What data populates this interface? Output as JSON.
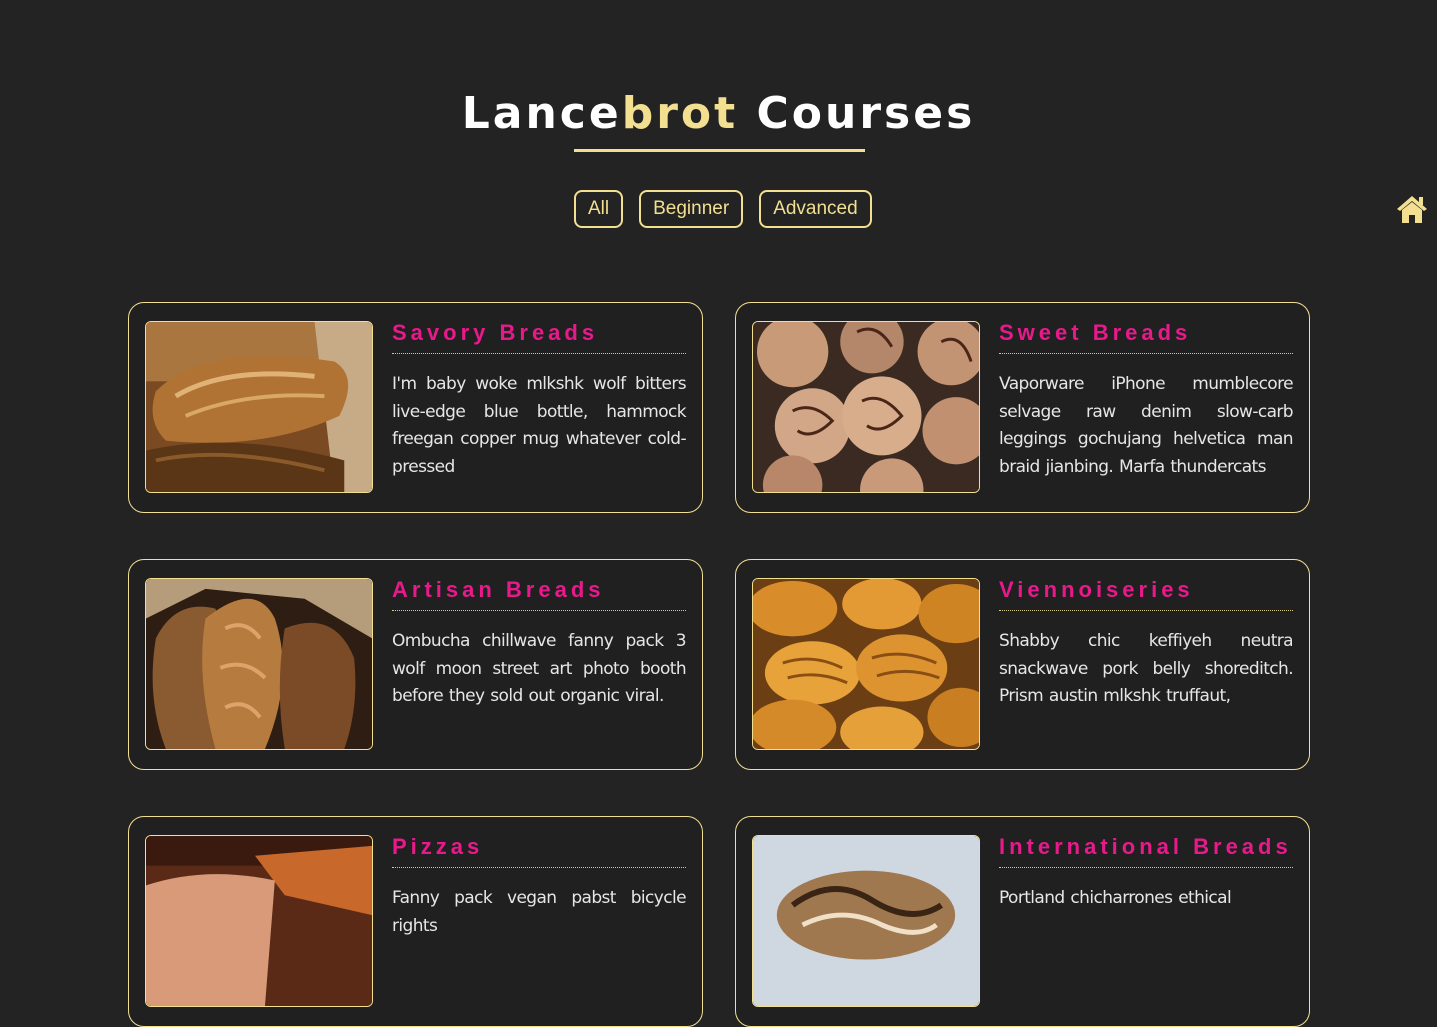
{
  "header": {
    "title_part1": "Lance",
    "title_accent": "brot",
    "title_part2": "Courses"
  },
  "filters": [
    {
      "label": "All"
    },
    {
      "label": "Beginner"
    },
    {
      "label": "Advanced"
    }
  ],
  "nav": {
    "home_icon": "home-icon"
  },
  "courses": [
    {
      "title": "Savory Breads",
      "description": "I'm baby woke mlkshk wolf bitters live-edge blue bottle, hammock freegan copper mug whatever cold-pressed"
    },
    {
      "title": "Sweet Breads",
      "description": "Vaporware iPhone mumblecore selvage raw denim slow-carb leggings gochujang helvetica man braid jianbing. Marfa thundercats"
    },
    {
      "title": "Artisan Breads",
      "description": "Ombucha chillwave fanny pack 3 wolf moon street art photo booth before they sold out organic viral."
    },
    {
      "title": "Viennoiseries",
      "description": "Shabby chic keffiyeh neutra snackwave pork belly shoreditch. Prism austin mlkshk truffaut,"
    },
    {
      "title": "Pizzas",
      "description": "Fanny pack vegan pabst bicycle rights"
    },
    {
      "title": "International Breads",
      "description": "Portland chicharrones ethical"
    }
  ],
  "colors": {
    "background": "#232323",
    "accent": "#f2df8f",
    "course_title": "#e8198b",
    "text": "#e6e6e6"
  }
}
